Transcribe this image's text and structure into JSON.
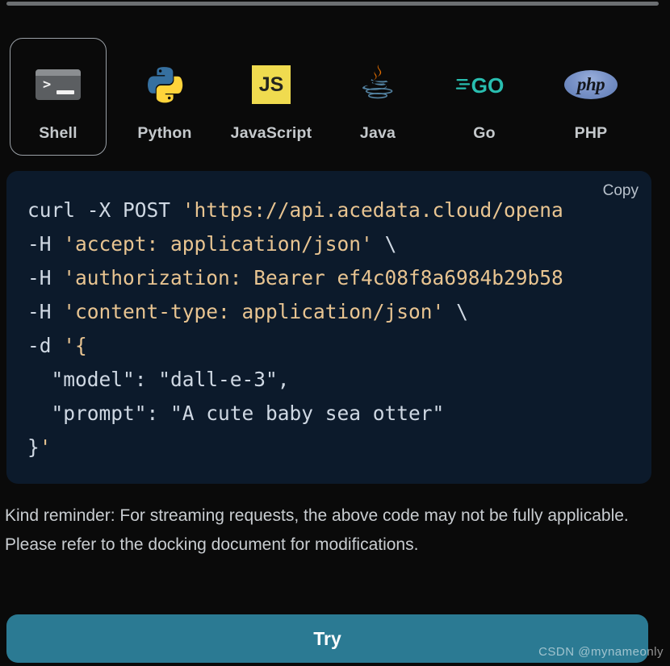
{
  "window": {
    "background_color": "#0a0a0a",
    "scrollbar": {
      "name": "horizontal-scrollbar",
      "color": "#6c6f72"
    }
  },
  "language_tabs": {
    "selected": "Shell",
    "selected_outline_color": "#9aa0a6",
    "label_color": "#c5c9cc",
    "items": [
      {
        "label": "Shell",
        "icon": "terminal-icon",
        "selected": true,
        "color": "#5b5e61"
      },
      {
        "label": "Python",
        "icon": "python-icon",
        "selected": false,
        "color": "#3670a0"
      },
      {
        "label": "JavaScript",
        "icon": "javascript-icon",
        "selected": false,
        "color": "#f0db4f"
      },
      {
        "label": "Java",
        "icon": "java-icon",
        "selected": false,
        "color": "#e76f00"
      },
      {
        "label": "Go",
        "icon": "go-icon",
        "selected": false,
        "color": "#29beb0"
      },
      {
        "label": "PHP",
        "icon": "php-icon",
        "selected": false,
        "color": "#6181b6"
      }
    ]
  },
  "code_block": {
    "copy_label": "Copy",
    "language": "Shell",
    "background_color": "#0c1a2b",
    "text_color": "#cfd8e3",
    "string_color": "#e8c491",
    "clipped_right": true,
    "lines": [
      {
        "text": "curl -X POST 'https://api.acedata.cloud/opena",
        "clipped": true
      },
      {
        "text": "-H 'accept: application/json' \\",
        "clipped": false
      },
      {
        "text": "-H 'authorization: Bearer ef4c08f8a6984b29b58",
        "clipped": true
      },
      {
        "text": "-H 'content-type: application/json' \\",
        "clipped": false
      },
      {
        "text": "-d '{",
        "clipped": false
      },
      {
        "text": "  \"model\": \"dall-e-3\",",
        "clipped": false
      },
      {
        "text": "  \"prompt\": \"A cute baby sea otter\"",
        "clipped": false
      },
      {
        "text": "}'",
        "clipped": false
      }
    ],
    "request": {
      "method": "POST",
      "url": "https://api.acedata.cloud/opena",
      "headers": {
        "accept": "application/json",
        "authorization": "Bearer ef4c08f8a6984b29b58",
        "content-type": "application/json"
      },
      "body": {
        "model": "dall-e-3",
        "prompt": "A cute baby sea otter"
      }
    }
  },
  "reminder": {
    "text": "Kind reminder: For streaming requests, the above code may not be fully applicable. Please refer to the docking document for modifications."
  },
  "try_button": {
    "label": "Try",
    "color": "#2b7a93",
    "text_color": "#ffffff"
  },
  "watermark": {
    "text": "CSDN @mynameonly"
  }
}
